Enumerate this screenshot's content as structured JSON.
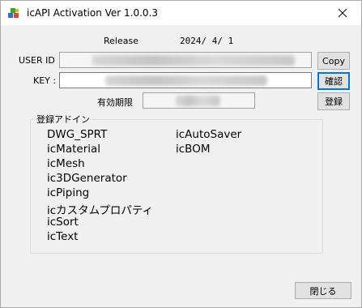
{
  "window": {
    "title": "icAPI Activation Ver 1.0.0.3",
    "icon": "app-blocks-icon",
    "close_icon": "close-icon"
  },
  "release": {
    "label": "Release",
    "date": "2024/ 4/ 1"
  },
  "user_id": {
    "label": "USER ID",
    "value_redacted": true,
    "copy_button": "Copy"
  },
  "key": {
    "label": "KEY :",
    "value_redacted": true,
    "confirm_button": "確認"
  },
  "expiry": {
    "label": "有効期限",
    "value_redacted": true,
    "register_button": "登録"
  },
  "addins": {
    "group_label": "登録アドイン",
    "col1": [
      "DWG_SPRT",
      "icMaterial",
      "icMesh",
      "ic3DGenerator",
      "icPiping",
      "icカスタムプロパティ",
      "icSort",
      "icText"
    ],
    "col2": [
      "icAutoSaver",
      "icBOM"
    ]
  },
  "footer": {
    "close_button": "閉じる"
  },
  "colors": {
    "window_bg": "#f0f0f0",
    "focus_border": "#0078d7"
  }
}
